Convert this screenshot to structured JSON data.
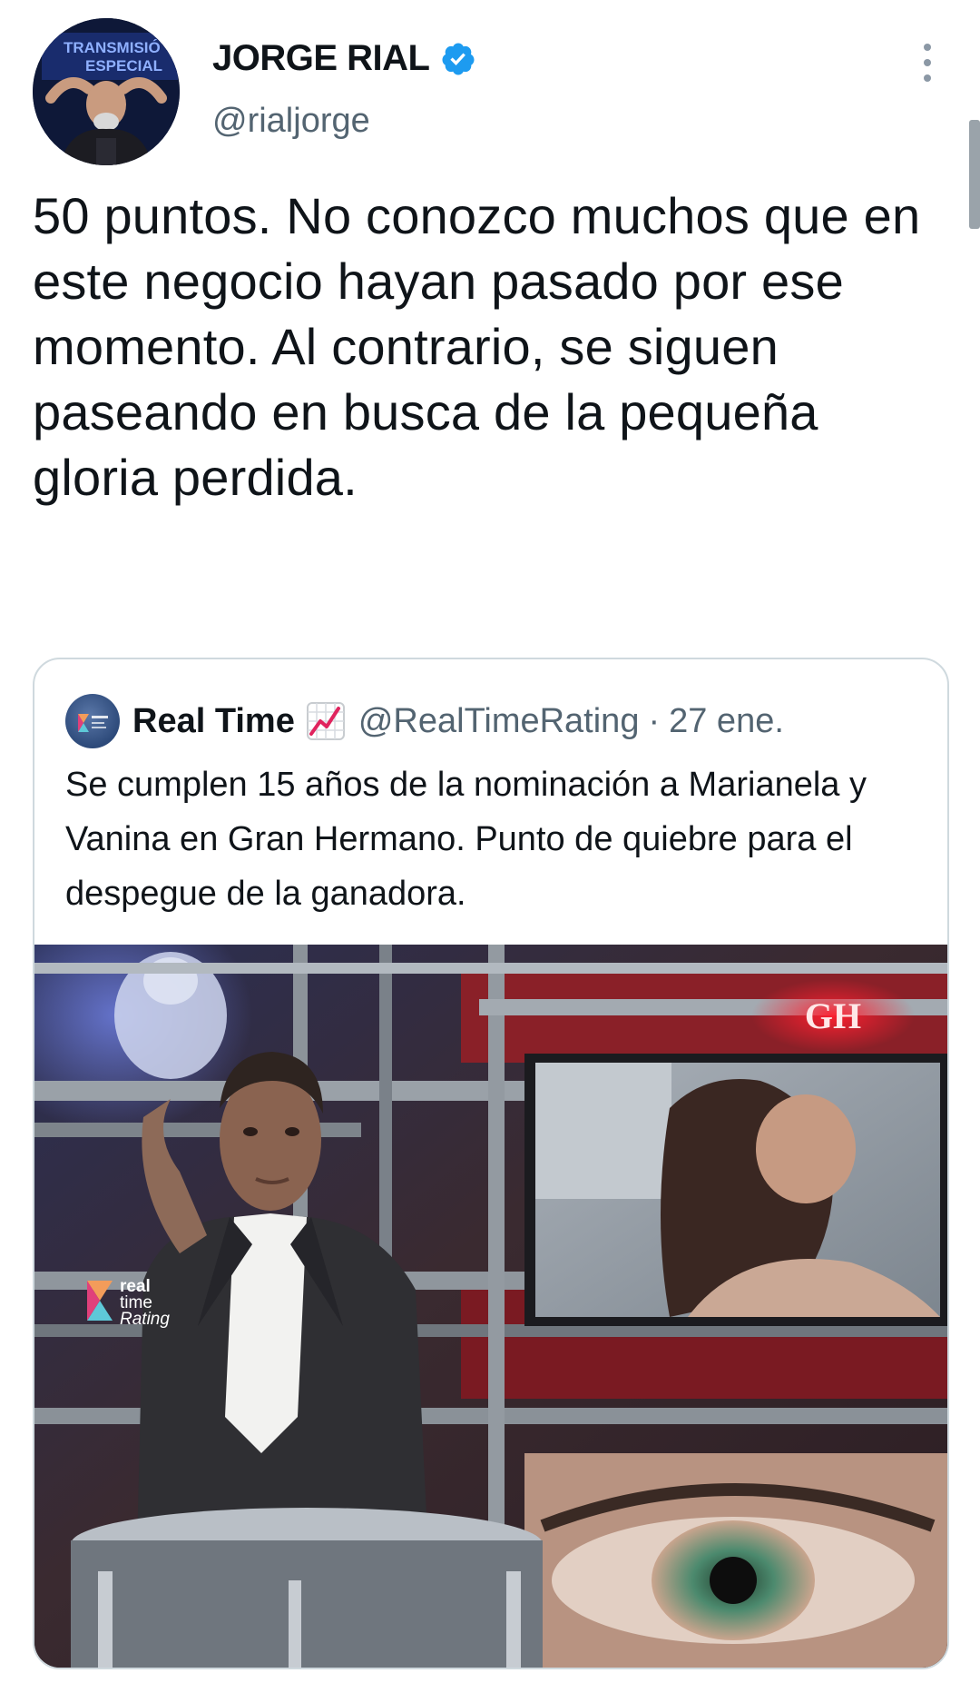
{
  "author": {
    "display_name": "JORGE RIAL",
    "handle": "@rialjorge",
    "verified": true,
    "avatar_banner_text": "TRANSMISIÓN ESPECIAL"
  },
  "tweet": {
    "text": "50 puntos. No conozco muchos que en este negocio hayan pasado por ese momento. Al contrario, se siguen paseando en busca de la pequeña gloria perdida."
  },
  "quoted_tweet": {
    "display_name": "Real Time",
    "emoji": "chart-increasing",
    "handle": "@RealTimeRating",
    "separator": "·",
    "date": "27 ene.",
    "text": "Se cumplen 15 años de la nominación a Marianela y Vanina en Gran Hermano. Punto de quiebre para el despegue de la ganadora.",
    "media": {
      "watermark": [
        "real",
        "time",
        "Rating"
      ],
      "logo_text": "GH"
    }
  },
  "colors": {
    "verified_blue": "#1d9bf0",
    "text_primary": "#0f1419",
    "text_secondary": "#536471",
    "border": "#cfd9de"
  }
}
